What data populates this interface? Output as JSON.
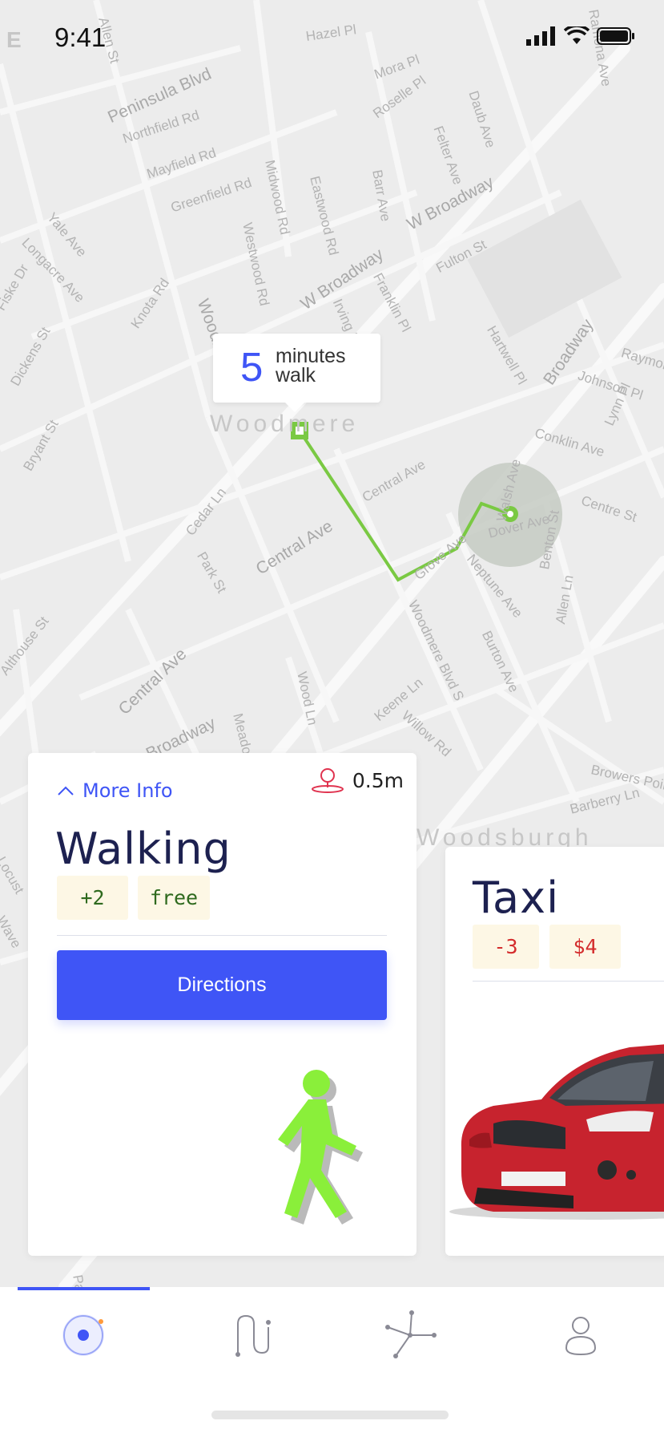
{
  "status_bar": {
    "carrier": "E",
    "time": "9:41"
  },
  "map": {
    "streets": [
      "Allen St",
      "Hazel Pl",
      "Ramona Ave",
      "Mora Pl",
      "Peninsula Blvd",
      "Roselle Pl",
      "Daub Ave",
      "Northfield Rd",
      "Felter Ave",
      "Mayfield Rd",
      "Barr Ave",
      "Greenfield Rd",
      "Midwood Rd",
      "Eastwood Rd",
      "W Broadway",
      "Yale Ave",
      "Westwood Rd",
      "Fulton St",
      "Longacre Ave",
      "W Broadway",
      "Franklin Pl",
      "Fiske Dr",
      "Knota Rd",
      "Woodmere",
      "Irving Pl",
      "Hartwell Pl",
      "Broadway",
      "Raymond",
      "Johnson Pl",
      "Dickens St",
      "Lynn Pl",
      "Conklin Ave",
      "Central Ave",
      "Bryant St",
      "Cedar Ln",
      "Walsh Ave",
      "Centre St",
      "Park St",
      "Central Ave",
      "Grove Ave",
      "Dover Ave",
      "Neptune Ave",
      "Benton St",
      "Allen Ln",
      "Althouse St",
      "Woodmere Blvd S",
      "Central Ave",
      "Burton Ave",
      "Wood Ln",
      "Keene Ln",
      "Willow Rd",
      "Broadway",
      "Meadow",
      "Browers Point",
      "Barberry Ln",
      "Woodsburgh",
      "Locust",
      "Wave",
      "Park"
    ],
    "area_label": "Woodmere",
    "walk_bubble": {
      "minutes": "5",
      "label": "minutes walk"
    },
    "route_color": "#7ac943"
  },
  "walking_card": {
    "more_info": "More Info",
    "distance": "0.5m",
    "title": "Walking",
    "tags": [
      "+2",
      "free"
    ],
    "button": "Directions"
  },
  "taxi_card": {
    "title": "Taxi",
    "tags": [
      "-3",
      "$4"
    ]
  },
  "tab_bar": {
    "tabs": [
      {
        "icon": "location-target-icon",
        "active": true
      },
      {
        "icon": "route-icon",
        "active": false
      },
      {
        "icon": "network-nodes-icon",
        "active": false
      },
      {
        "icon": "profile-icon",
        "active": false
      }
    ],
    "accent": "#3f55f6"
  }
}
